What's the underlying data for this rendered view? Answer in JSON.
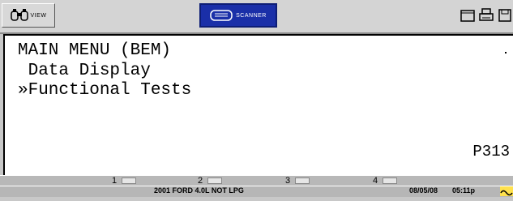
{
  "toolbar": {
    "view_label": "VIEW",
    "scanner_label": "SCANNER"
  },
  "screen": {
    "title": "MAIN MENU (BEM)",
    "items": [
      " Data Display",
      "»Functional Tests"
    ],
    "code": "P313"
  },
  "fkeys": [
    "1",
    "2",
    "3",
    "4"
  ],
  "status": {
    "vehicle": "2001 FORD 4.0L NOT LPG",
    "date": "08/05/08",
    "time": "05:11p"
  },
  "colors": {
    "scanner_button": "#1a2fa8",
    "screen_bg": "#ffffff",
    "chrome": "#c8c8c8"
  }
}
